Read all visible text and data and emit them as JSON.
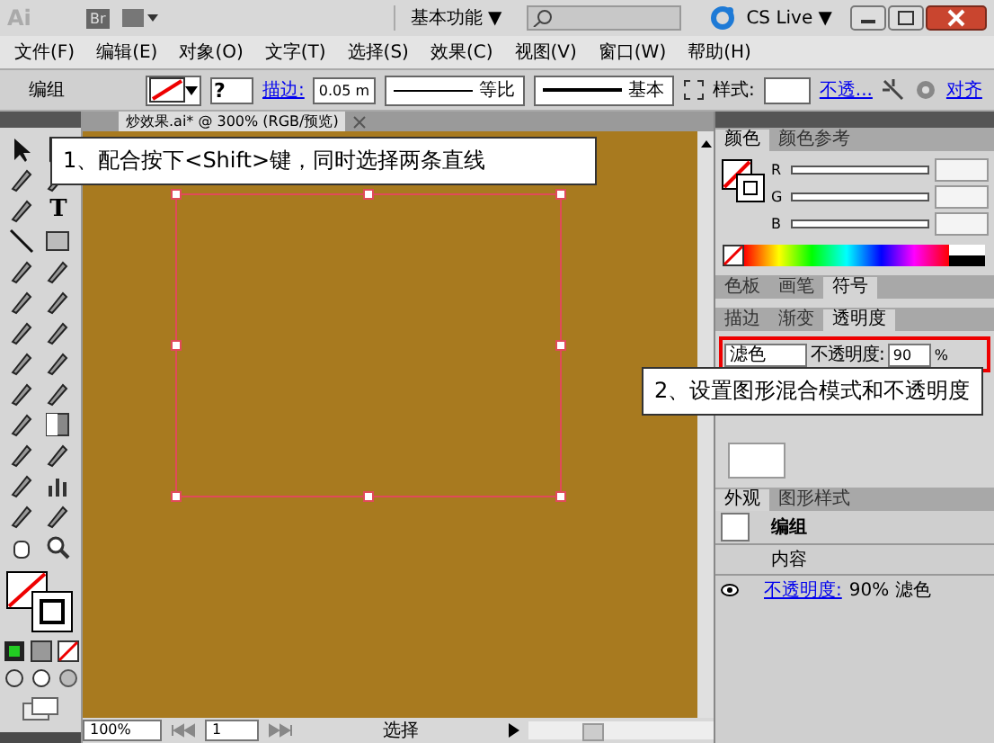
{
  "title_bar": {
    "app_logo": "Ai",
    "bridge": "Br",
    "workspace": "基本功能",
    "caret": "▼",
    "cs_live": "CS Live",
    "cs_caret": "▼"
  },
  "menu": [
    "文件(F)",
    "编辑(E)",
    "对象(O)",
    "文字(T)",
    "选择(S)",
    "效果(C)",
    "视图(V)",
    "窗口(W)",
    "帮助(H)"
  ],
  "control_bar": {
    "selection": "编组",
    "fill_mark": "?",
    "stroke_link": "描边:",
    "stroke_weight": "0.05 m",
    "profile": "等比",
    "brush": "基本",
    "style_label": "样式:",
    "opacity_link": "不透...",
    "align_link": "对齐"
  },
  "document_tab": {
    "title": "炒效果.ai* @ 300% (RGB/预览)"
  },
  "tools": {
    "type_tool": "T"
  },
  "callouts": [
    {
      "text": "1、配合按下<Shift>键，同时选择两条直线"
    },
    {
      "text": "2、设置图形混合模式和不透明度"
    }
  ],
  "color_panel": {
    "tabs": [
      {
        "label": "颜色",
        "selected": true
      },
      {
        "label": "颜色参考",
        "selected": false
      }
    ],
    "channels": [
      {
        "label": "R",
        "level": 0
      },
      {
        "label": "G",
        "level": 0
      },
      {
        "label": "B",
        "level": 0
      }
    ]
  },
  "swatch_tabs": [
    {
      "label": "色板",
      "selected": false
    },
    {
      "label": "画笔",
      "selected": false
    },
    {
      "label": "符号",
      "selected": true
    }
  ],
  "transparency_panel": {
    "tabs": [
      {
        "label": "描边",
        "selected": false
      },
      {
        "label": "渐变",
        "selected": false
      },
      {
        "label": "透明度",
        "selected": true
      }
    ],
    "blend_mode": "滤色",
    "opacity_label": "不透明度:",
    "opacity": "90",
    "percent": "%",
    "highlighted": true
  },
  "appearance_panel": {
    "tabs": [
      {
        "label": "外观",
        "selected": true
      },
      {
        "label": "图形样式",
        "selected": false
      }
    ],
    "rows": [
      {
        "kind": "object",
        "label": "编组"
      },
      {
        "kind": "item",
        "label": "内容"
      },
      {
        "kind": "attribute",
        "link": "不透明度:",
        "value": "90% 滤色"
      }
    ]
  },
  "status_bar": {
    "zoom": "100%",
    "page": "1",
    "tool": "选择"
  }
}
